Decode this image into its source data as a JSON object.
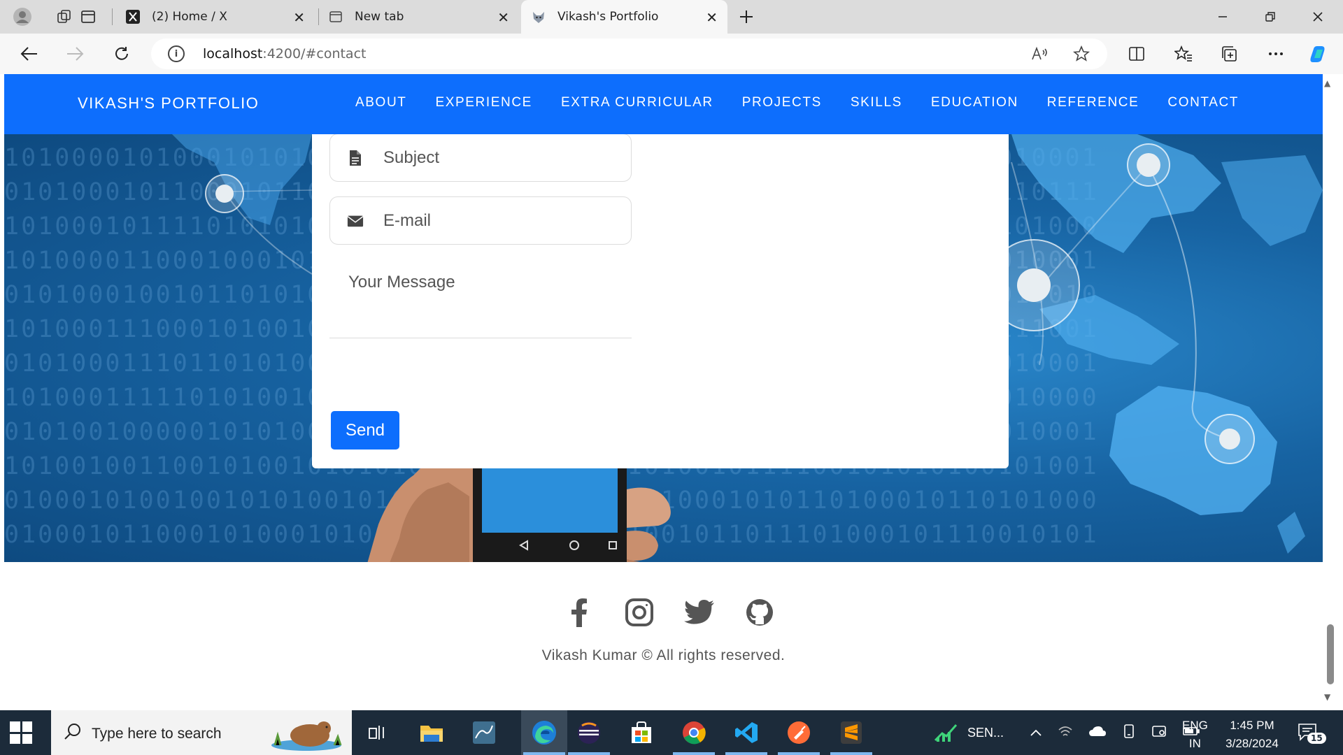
{
  "browser": {
    "tabs": [
      {
        "title": "(2) Home / X",
        "icon": "x-logo-icon"
      },
      {
        "title": "New tab",
        "icon": "new-tab-icon"
      },
      {
        "title": "Vikash's Portfolio",
        "icon": "wolf-logo-icon",
        "active": true
      }
    ],
    "url_host": "localhost",
    "url_rest": ":4200/#contact"
  },
  "page": {
    "brand": "VIKASH'S PORTFOLIO",
    "menu": [
      "ABOUT",
      "EXPERIENCE",
      "EXTRA CURRICULAR",
      "PROJECTS",
      "SKILLS",
      "EDUCATION",
      "REFERENCE",
      "CONTACT"
    ],
    "form": {
      "subject_placeholder": "Subject",
      "email_placeholder": "E-mail",
      "message_placeholder": "Your Message",
      "send_label": "Send"
    },
    "binary_rows": [
      "10100001010001010100101000101000101000110100010101000100101010001",
      "01010001011000101100101001110101101010100101010101010100101110111",
      "10100010111101010101010101010101010101100101010100101011000101000",
      "10100001100010001010010110101010101001010101010010110101001010001",
      "01010001001011010101001010101010101010100101010101110111101010010",
      "10100011100010100101010101010101010101010010101010100111010111001",
      "01010001110110101001010101010101010101010101010101011010101010001",
      "10100011111010100101010101010101010101010000001010101010101010000",
      "01010010000010101001010100101010101010100000001000101010101010001",
      "10100100110010100101010101010100100101010010111100101010100101001",
      "01000101001001010100101010110101010101010001010110100010110101000",
      "01000101100010100010100101010101010101001011011101000101110010101"
    ],
    "footer": {
      "socials": [
        "facebook-icon",
        "instagram-icon",
        "twitter-icon",
        "github-icon"
      ],
      "copyright": "Vikash Kumar © All rights reserved."
    }
  },
  "taskbar": {
    "search_placeholder": "Type here to search",
    "tray_app": "SEN...",
    "lang_top": "ENG",
    "lang_bottom": "IN",
    "time": "1:45 PM",
    "date": "3/28/2024",
    "notification_count": "15"
  }
}
